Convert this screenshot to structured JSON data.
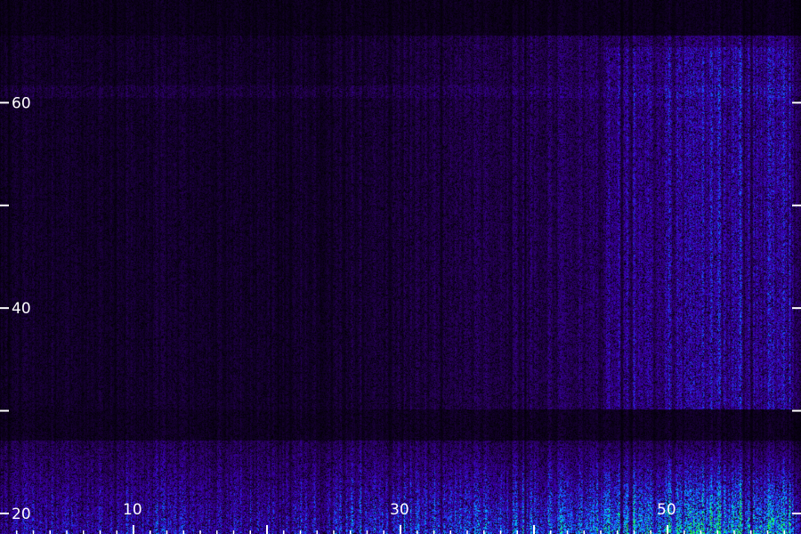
{
  "chart_data": {
    "type": "heatmap",
    "title": "",
    "xlabel": "",
    "ylabel": "",
    "x_range": [
      0,
      60
    ],
    "y_range": [
      18,
      70
    ],
    "x_ticks": [
      {
        "value": 10,
        "label": "10"
      },
      {
        "value": 20,
        "label": ""
      },
      {
        "value": 30,
        "label": "30"
      },
      {
        "value": 40,
        "label": ""
      },
      {
        "value": 50,
        "label": "50"
      }
    ],
    "y_ticks": [
      {
        "value": 20,
        "label": "20"
      },
      {
        "value": 30,
        "label": ""
      },
      {
        "value": 40,
        "label": "40"
      },
      {
        "value": 50,
        "label": ""
      },
      {
        "value": 60,
        "label": "60"
      }
    ],
    "colormap": [
      "#000000",
      "#2a0060",
      "#3a00c0",
      "#1060ff",
      "#00d0ff",
      "#20ff40"
    ],
    "grid": false,
    "legend": "none"
  }
}
